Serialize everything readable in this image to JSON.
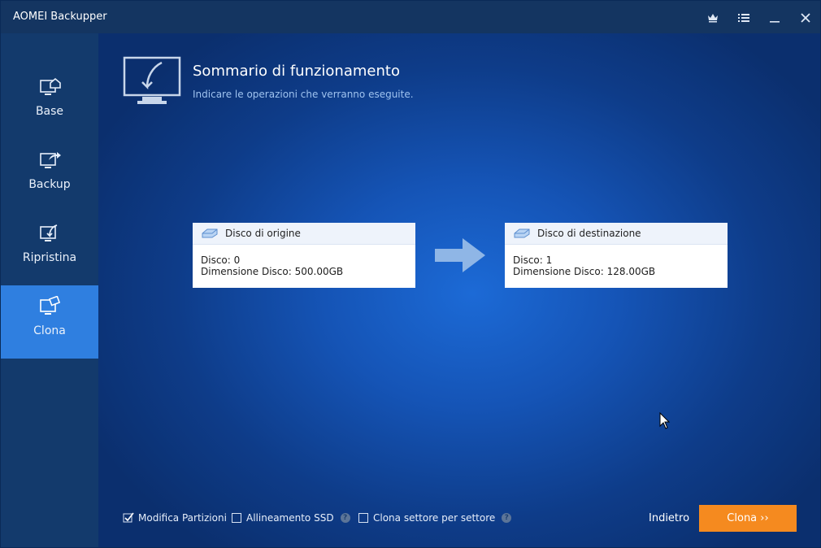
{
  "window": {
    "title": "AOMEI Backupper"
  },
  "titlebar": {
    "buttons": [
      "crown-icon",
      "menu-icon",
      "minimize-icon",
      "close-icon"
    ]
  },
  "sidebar": {
    "items": [
      {
        "label": "Base",
        "icon": "home-monitor-icon",
        "active": false
      },
      {
        "label": "Backup",
        "icon": "backup-monitor-icon",
        "active": false
      },
      {
        "label": "Ripristina",
        "icon": "restore-monitor-icon",
        "active": false
      },
      {
        "label": "Clona",
        "icon": "clone-monitor-icon",
        "active": true
      }
    ]
  },
  "header": {
    "title": "Sommario di funzionamento",
    "subtitle": "Indicare le operazioni che verranno eseguite."
  },
  "source": {
    "title": "Disco di origine",
    "line1": "Disco: 0",
    "line2": "Dimensione Disco: 500.00GB"
  },
  "destination": {
    "title": "Disco di destinazione",
    "line1": "Disco: 1",
    "line2": "Dimensione Disco: 128.00GB"
  },
  "options": {
    "edit_partitions": {
      "label": "Modifica Partizioni",
      "checked": true
    },
    "ssd_alignment": {
      "label": "Allineamento SSD",
      "checked": false
    },
    "sector_clone": {
      "label": "Clona settore per settore",
      "checked": false
    }
  },
  "footer": {
    "back_label": "Indietro",
    "clone_label": "Clona ››"
  },
  "colors": {
    "accent": "#2f7fe0",
    "primary_button": "#f58a1f",
    "titlebar": "#143561",
    "sidebar": "#133a6c"
  }
}
